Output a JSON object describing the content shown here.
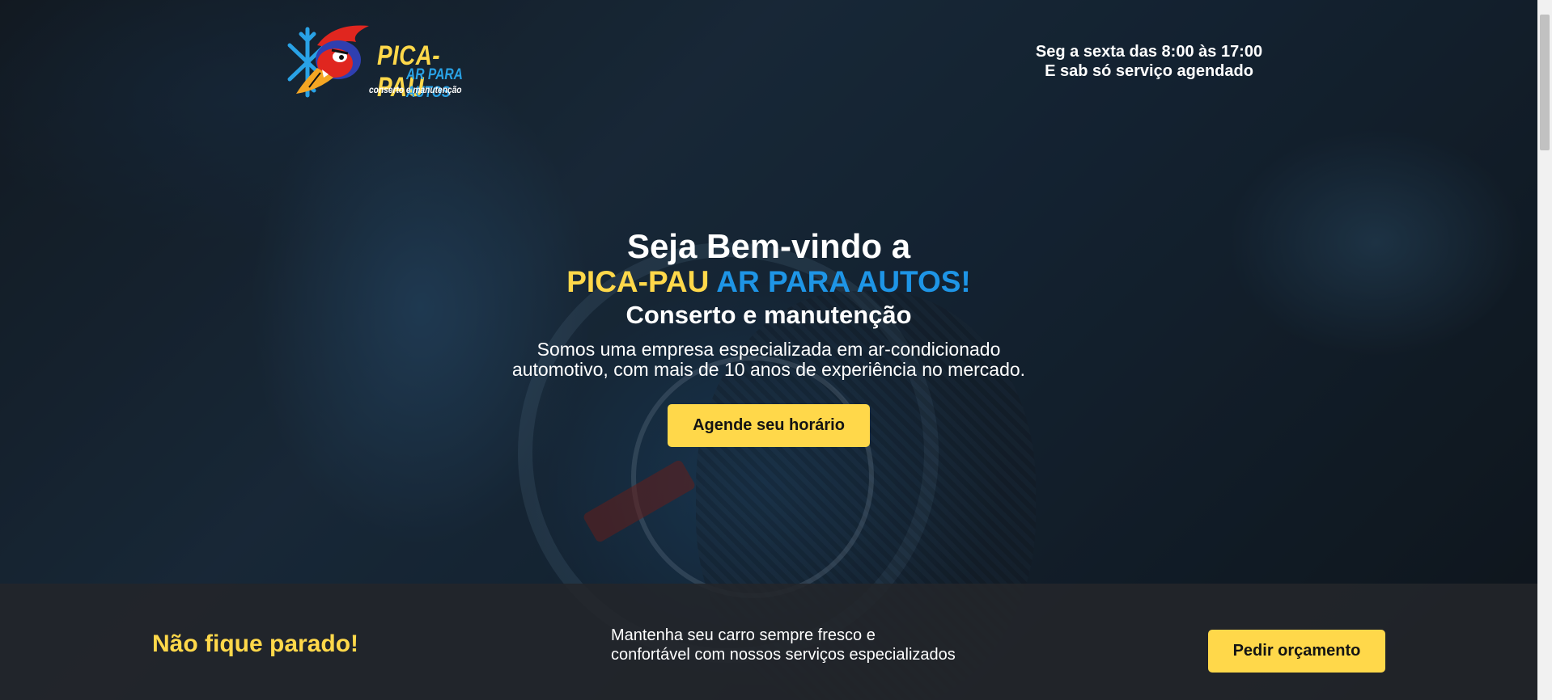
{
  "logo": {
    "title": "PICA-PAU",
    "subtitle": "AR PARA AUTOS",
    "tagline": "conserto e manutenção"
  },
  "hours": {
    "line1": "Seg a sexta das 8:00 às 17:00",
    "line2": "E sab só serviço agendado"
  },
  "hero": {
    "welcome": "Seja Bem-vindo a",
    "brand_part1": "PICA-PAU",
    "brand_part2": "AR PARA AUTOS!",
    "subtitle": "Conserto e manutenção",
    "description": "Somos uma empresa especializada em ar-condicionado automotivo, com mais de 10 anos de experiência no mercado.",
    "cta_label": "Agende seu horário"
  },
  "bottom_bar": {
    "title": "Não fique parado!",
    "text_line1": "Mantenha seu carro sempre fresco e",
    "text_line2": "confortável com nossos serviços especializados",
    "button_label": "Pedir orçamento"
  },
  "colors": {
    "accent_yellow": "#ffd84a",
    "accent_blue": "#1e95e6",
    "bar_background": "#23262a"
  },
  "icons": {
    "logo_mascot": "woodpecker-mascot-icon",
    "logo_snowflake": "snowflake-icon"
  }
}
